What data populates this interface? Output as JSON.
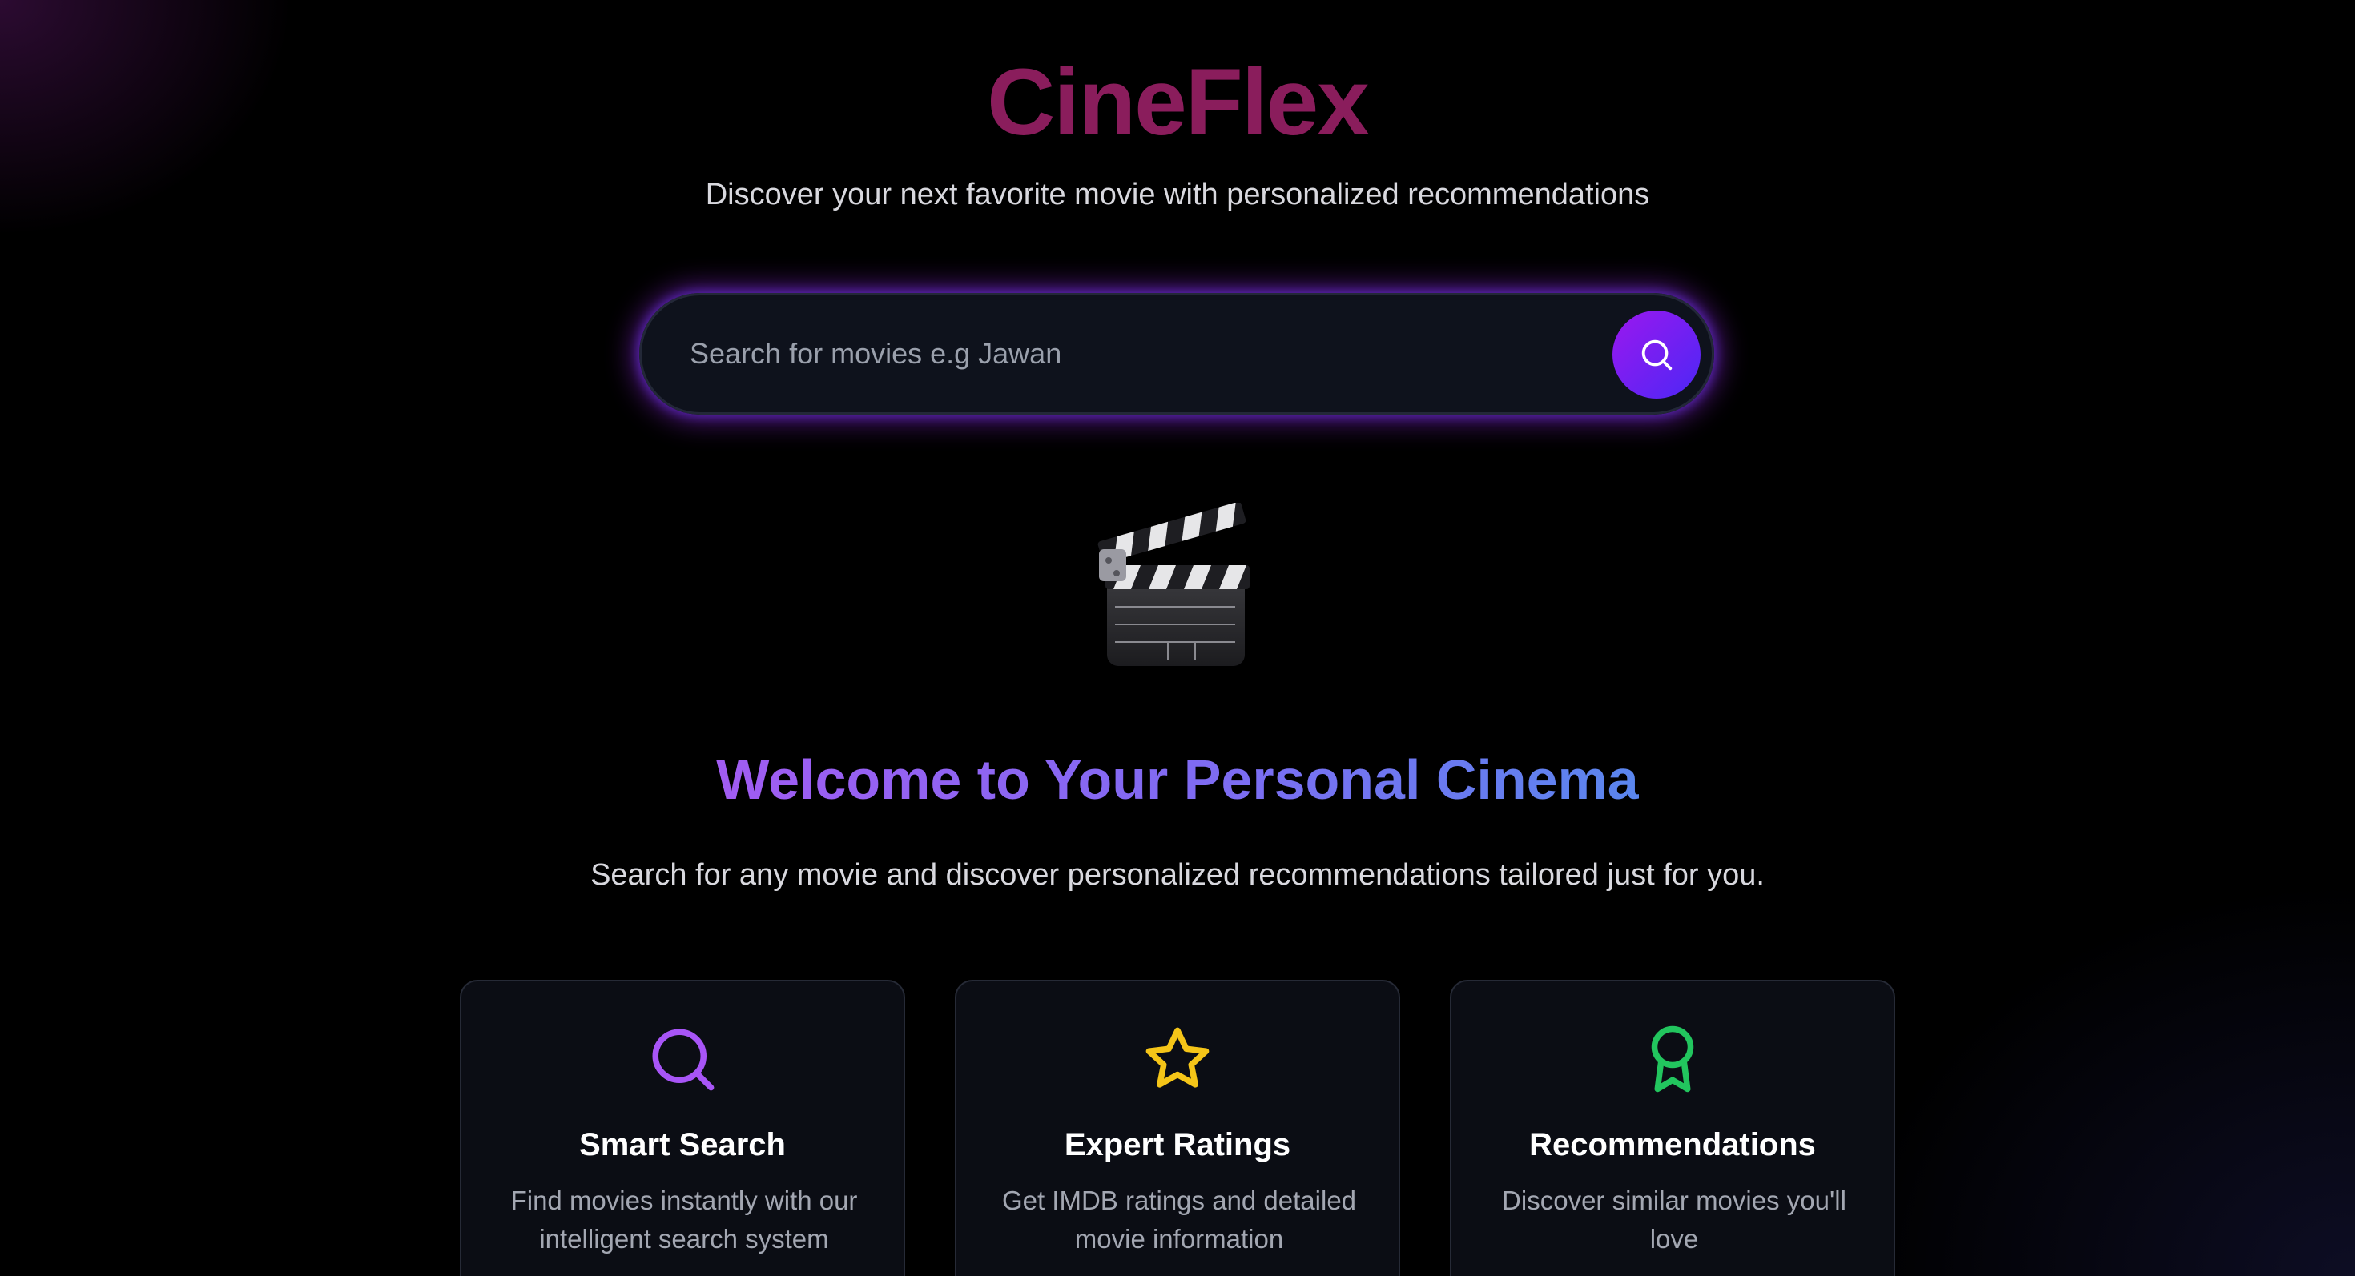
{
  "header": {
    "logo": "CineFlex",
    "tagline": "Discover your next favorite movie with personalized recommendations"
  },
  "search": {
    "placeholder": "Search for movies e.g Jawan",
    "button_icon": "search-icon"
  },
  "hero": {
    "icon": "clapper-board-icon",
    "title": "Welcome to Your Personal Cinema",
    "subtitle": "Search for any movie and discover personalized recommendations tailored just for you."
  },
  "features": [
    {
      "icon": "search-icon",
      "color": "#a855f7",
      "title": "Smart Search",
      "description": "Find movies instantly with our intelligent search system"
    },
    {
      "icon": "star-icon",
      "color": "#f5c518",
      "title": "Expert Ratings",
      "description": "Get IMDB ratings and detailed movie information"
    },
    {
      "icon": "award-icon",
      "color": "#22c55e",
      "title": "Recommendations",
      "description": "Discover similar movies you'll love"
    }
  ],
  "colors": {
    "background": "#000000",
    "logo": "#8a1d5c",
    "accent_from": "#9b18ef",
    "accent_to": "#4c27f5"
  }
}
